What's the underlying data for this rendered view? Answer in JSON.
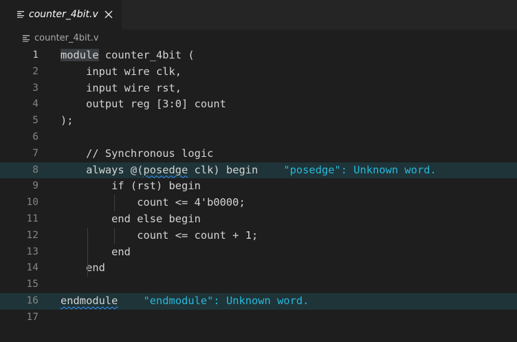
{
  "tab": {
    "title": "counter_4bit.v",
    "icon": "file-lines-icon",
    "close_icon": "close-icon"
  },
  "breadcrumb": {
    "label": "counter_4bit.v",
    "icon": "file-lines-icon"
  },
  "editor": {
    "active_line": 1,
    "lines": [
      {
        "num": "1",
        "text": "module counter_4bit (",
        "highlight_word": "module"
      },
      {
        "num": "2",
        "text": "    input wire clk,"
      },
      {
        "num": "3",
        "text": "    input wire rst,"
      },
      {
        "num": "4",
        "text": "    output reg [3:0] count"
      },
      {
        "num": "5",
        "text": ");"
      },
      {
        "num": "6",
        "text": ""
      },
      {
        "num": "7",
        "text": "    // Synchronous logic"
      },
      {
        "num": "8",
        "text_before": "    always @(",
        "squiggle": "posedge",
        "text_after": " clk) begin",
        "diagnostic": "\"posedge\": Unknown word.",
        "highlighted": true
      },
      {
        "num": "9",
        "text": "        if (rst) begin"
      },
      {
        "num": "10",
        "text": "            count <= 4'b0000;"
      },
      {
        "num": "11",
        "text": "        end else begin"
      },
      {
        "num": "12",
        "text": "            count <= count + 1;"
      },
      {
        "num": "13",
        "text": "        end"
      },
      {
        "num": "14",
        "text": "    end"
      },
      {
        "num": "15",
        "text": ""
      },
      {
        "num": "16",
        "text_before": "",
        "squiggle": "endmodule",
        "text_after": "",
        "diagnostic": "\"endmodule\": Unknown word.",
        "highlighted": true
      },
      {
        "num": "17",
        "text": ""
      }
    ]
  },
  "colors": {
    "background": "#1e1e1e",
    "tabbar": "#252526",
    "text": "#d4d4d4",
    "line_number": "#858585",
    "diagnostic": "#29b8db",
    "line_highlight": "#1e3438",
    "squiggle": "#3794ff"
  }
}
